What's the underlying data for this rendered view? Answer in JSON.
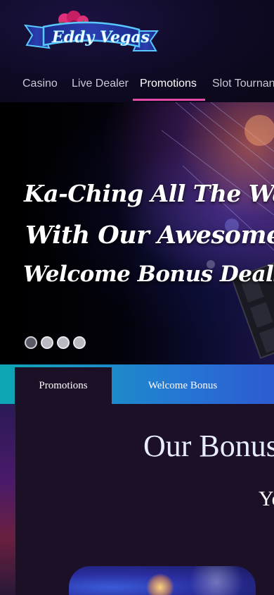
{
  "brand": {
    "logo_text": "Eddy Vegas"
  },
  "nav": {
    "items": [
      {
        "label": "Casino",
        "active": false
      },
      {
        "label": "Live Dealer",
        "active": false
      },
      {
        "label": "Promotions",
        "active": true
      },
      {
        "label": "Slot Tournan",
        "active": false
      }
    ],
    "accent_color": "#e24aa8"
  },
  "hero": {
    "lines": [
      "Ka-Ching All The Way",
      "With Our Awesome",
      "Welcome Bonus Deals"
    ],
    "slides_count": 4,
    "active_slide": 1
  },
  "tabs": [
    {
      "label": "Promotions",
      "active": true
    },
    {
      "label": "Welcome Bonus",
      "active": false
    }
  ],
  "content": {
    "title": "Our Bonus",
    "subtitle": "Yo"
  },
  "colors": {
    "header_bg": "#0e0a24",
    "content_bg": "#1b1026",
    "tabs_gradient_start": "#0ea6b4",
    "tabs_gradient_end": "#2d5bd0"
  }
}
